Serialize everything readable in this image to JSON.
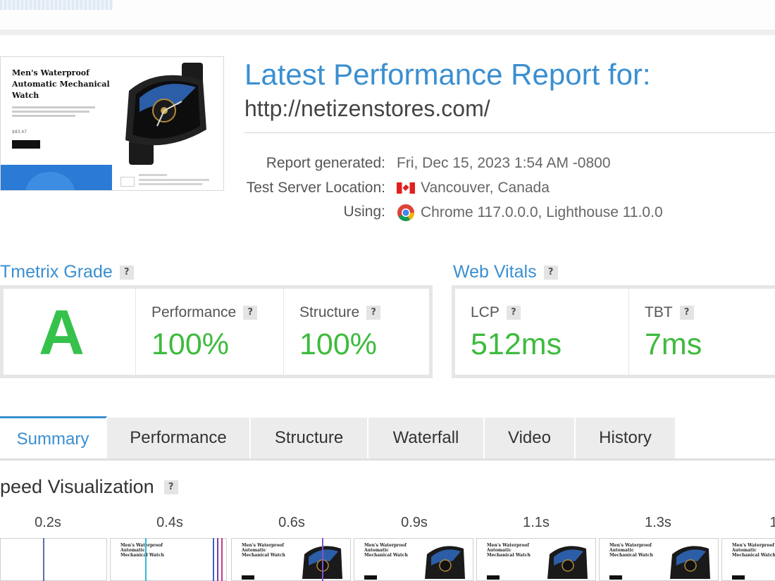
{
  "thumbnail": {
    "hero_title": "Men's Waterproof Automatic Mechanical Watch",
    "price": "$83.47"
  },
  "report": {
    "title": "Latest Performance Report for:",
    "url": "http://netizenstores.com/"
  },
  "meta": {
    "generated_label": "Report generated:",
    "generated_value": "Fri, Dec 15, 2023 1:54 AM -0800",
    "location_label": "Test Server Location:",
    "location_value": "Vancouver, Canada",
    "location_icon": "canada-flag-icon",
    "using_label": "Using:",
    "using_value": "Chrome 117.0.0.0, Lighthouse 11.0.0",
    "using_icon": "chrome-icon"
  },
  "grade": {
    "title": "Tmetrix Grade",
    "help": "?",
    "letter": "A",
    "performance_label": "Performance",
    "performance_value": "100%",
    "structure_label": "Structure",
    "structure_value": "100%"
  },
  "vitals": {
    "title": "Web Vitals",
    "help": "?",
    "lcp_label": "LCP",
    "lcp_value": "512ms",
    "tbt_label": "TBT",
    "tbt_value": "7ms"
  },
  "tabs": [
    {
      "label": "Summary",
      "active": true
    },
    {
      "label": "Performance",
      "active": false
    },
    {
      "label": "Structure",
      "active": false
    },
    {
      "label": "Waterfall",
      "active": false
    },
    {
      "label": "Video",
      "active": false
    },
    {
      "label": "History",
      "active": false
    }
  ],
  "speed": {
    "title": "peed Visualization",
    "help": "?",
    "ticks": [
      "0.2s",
      "0.4s",
      "0.6s",
      "0.9s",
      "1.1s",
      "1.3s",
      "1"
    ],
    "frame_title": "Men's Waterproof Automatic Mechanical Watch"
  },
  "colors": {
    "accent_blue": "#3a8fd1",
    "grade_green": "#36c24a",
    "value_green": "#3dbb3d",
    "panel_border": "#e6e6e6"
  }
}
